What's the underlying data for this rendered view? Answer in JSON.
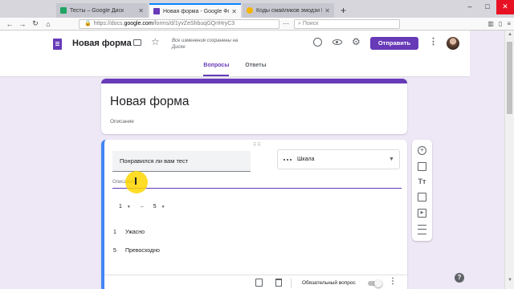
{
  "browser": {
    "tabs": [
      {
        "title": "Тесты – Google Диск",
        "favicon_color": "#1fa463",
        "active": false
      },
      {
        "title": "Новая форма - Google Формы",
        "favicon_color": "#673ab7",
        "active": true
      },
      {
        "title": "Коды смайликов эмодзи ВКон",
        "favicon_color": "#f4b400",
        "active": false
      }
    ],
    "url_prefix": "https://docs.",
    "url_host": "google.com",
    "url_rest": "/forms/d/1yvZeShbuqGQrIHryC3",
    "search_placeholder": "Поиск"
  },
  "header": {
    "form_title": "Новая форма",
    "save_status": "Все изменения сохранены на Диске",
    "send_label": "Отправить"
  },
  "tabs": [
    {
      "label": "Вопросы",
      "active": true
    },
    {
      "label": "Ответы",
      "active": false
    }
  ],
  "title_card": {
    "title": "Новая форма",
    "description_placeholder": "Описание"
  },
  "question": {
    "text": "Понравился ли вам тест",
    "type": "Шкала",
    "description_placeholder": "Описание",
    "range_from": "1",
    "range_dash": "–",
    "range_to": "5",
    "labels": [
      {
        "num": "1",
        "text": "Ужасно"
      },
      {
        "num": "5",
        "text": "Превосходно"
      }
    ],
    "required_label": "Обязательный вопрос",
    "required": false
  },
  "colors": {
    "accent": "#673ab7",
    "background": "#ede7f6",
    "active_card_border": "#4285f4"
  }
}
